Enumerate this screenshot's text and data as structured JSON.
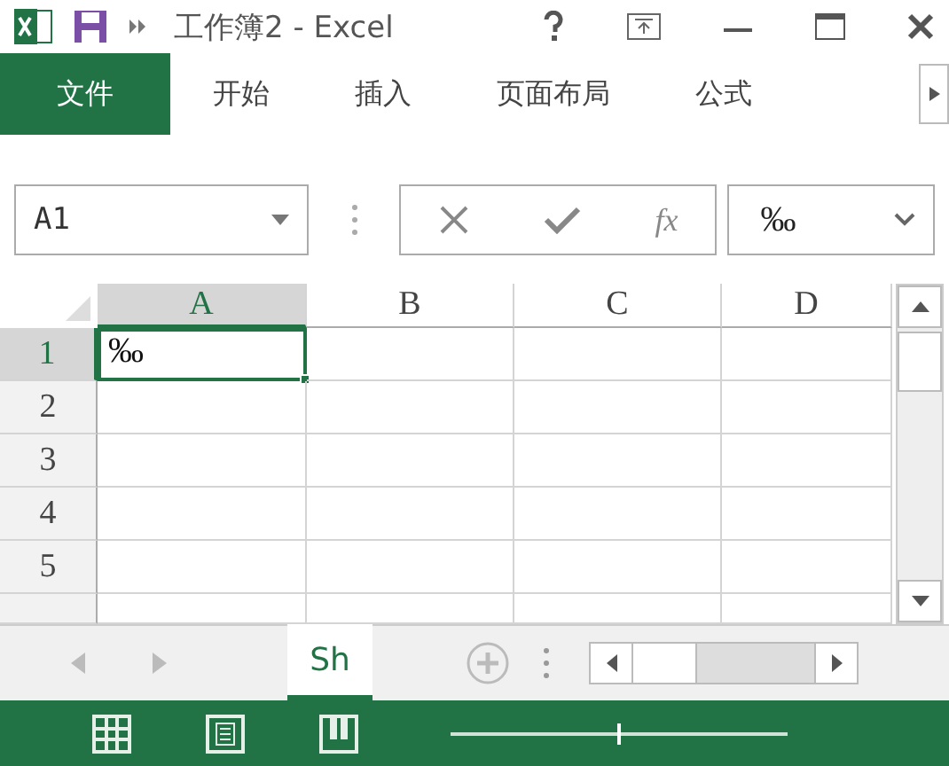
{
  "window": {
    "title": "工作簿2 - Excel"
  },
  "ribbon_tabs": [
    {
      "label": "文件",
      "kind": "file",
      "selected": false
    },
    {
      "label": "开始",
      "kind": "tab",
      "selected": false
    },
    {
      "label": "插入",
      "kind": "tab",
      "selected": false
    },
    {
      "label": "页面布局",
      "kind": "tab",
      "selected": false
    },
    {
      "label": "公式",
      "kind": "tab",
      "selected": false
    }
  ],
  "formula_bar": {
    "name_box": "A1",
    "function_button": "fx",
    "value": "‰"
  },
  "grid": {
    "columns": [
      {
        "label": "A",
        "selected": true
      },
      {
        "label": "B",
        "selected": false
      },
      {
        "label": "C",
        "selected": false
      },
      {
        "label": "D",
        "selected": false
      }
    ],
    "rows": [
      {
        "label": "1",
        "selected": true,
        "cells": [
          {
            "text": "‰",
            "selected": true
          }
        ]
      },
      {
        "label": "2",
        "selected": false
      },
      {
        "label": "3",
        "selected": false
      },
      {
        "label": "4",
        "selected": false
      },
      {
        "label": "5",
        "selected": false
      }
    ]
  },
  "sheet_tabs": [
    {
      "label": "Sh",
      "selected": true
    }
  ],
  "status_bar": {
    "zoom": {
      "level": 0.5
    }
  }
}
